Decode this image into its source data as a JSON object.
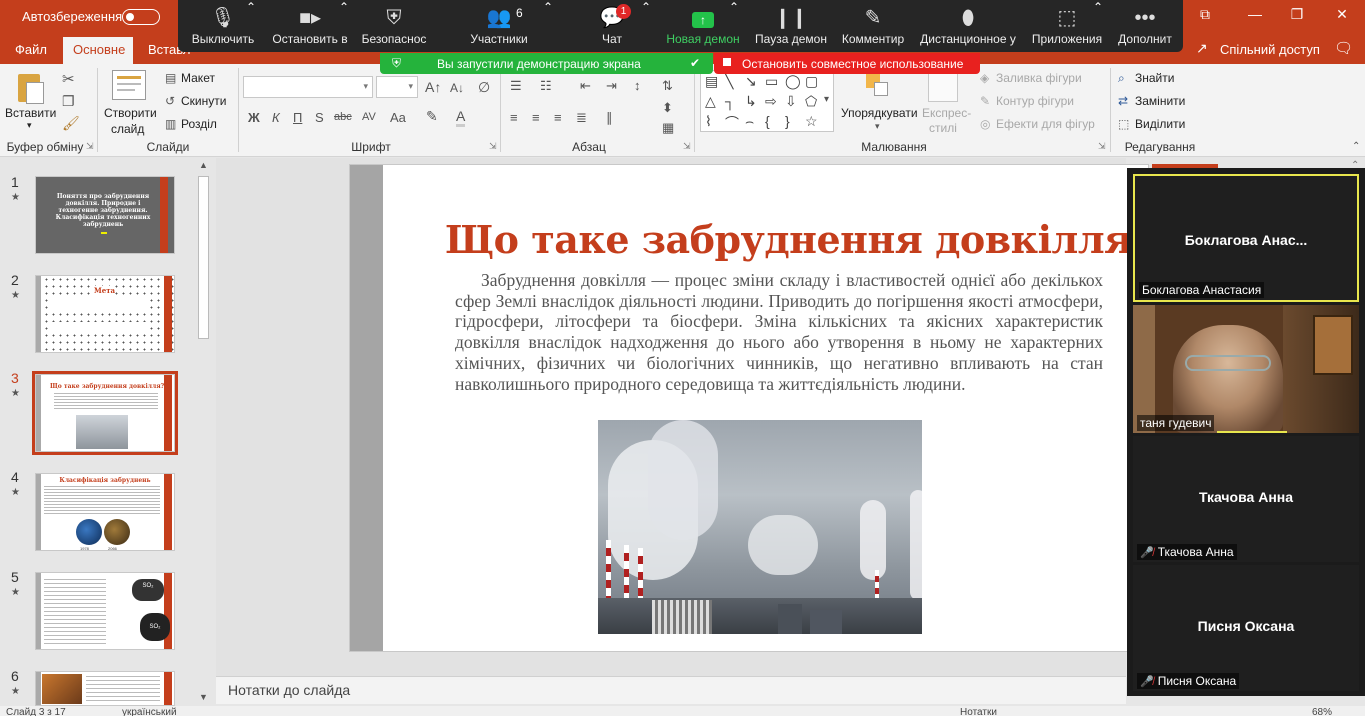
{
  "app": {
    "autosave_label": "Автозбереження",
    "autosave_state": "off",
    "share_label": "Спільний доступ",
    "accent": "#c43e1c",
    "window_controls": [
      "restore-small-icon",
      "minimize-icon",
      "maximize-icon",
      "close-icon"
    ]
  },
  "tabs": {
    "file": "Файл",
    "home": "Основне",
    "insert": "Вставл"
  },
  "zoom": {
    "mute": "Выключить",
    "stop_video": "Остановить в",
    "security": "Безопаснос",
    "participants": "Участники",
    "participants_count": "6",
    "chat": "Чат",
    "chat_badge": "1",
    "new_share": "Новая демон",
    "pause_share": "Пауза демон",
    "annotate": "Комментир",
    "remote": "Дистанционное у",
    "apps": "Приложения",
    "more": "Дополнит",
    "sharing_banner": "Вы запустили демонстрацию экрана",
    "stop_share": "Остановить совместное использование"
  },
  "ribbon": {
    "paste": "Вставити",
    "clipboard": "Буфер обміну",
    "new_slide_line1": "Створити",
    "new_slide_line2": "слайд",
    "layout": "Макет",
    "reset": "Скинути",
    "section": "Розділ",
    "slides": "Слайди",
    "font_group": "Шрифт",
    "paragraph": "Абзац",
    "arrange": "Упорядкувати",
    "quick_styles_line1": "Експрес-",
    "quick_styles_line2": "стилі",
    "shape_fill": "Заливка фігури",
    "shape_outline": "Контур фігури",
    "shape_effects": "Ефекти для фігур",
    "drawing": "Малювання",
    "find": "Знайти",
    "replace": "Замінити",
    "select": "Виділити",
    "editing": "Редагування",
    "bold": "Ж",
    "italic": "К",
    "underline": "П",
    "strike": "S",
    "abc": "abc",
    "spacing": "AV",
    "case": "Aa"
  },
  "thumbnails": [
    {
      "num": "1",
      "title": "Поняття про забруднення довкілля. Природне і техногенне забруднення. Класифікація техногенних забруднень",
      "selected": false
    },
    {
      "num": "2",
      "title": "Мета",
      "selected": false
    },
    {
      "num": "3",
      "title": "Що таке забруднення довкілля?",
      "selected": true
    },
    {
      "num": "4",
      "title": "Класифікація забруднень",
      "selected": false
    },
    {
      "num": "5",
      "title": "",
      "selected": false
    },
    {
      "num": "6",
      "title": "",
      "selected": false
    }
  ],
  "thumb4_years": [
    "1978",
    "2066"
  ],
  "thumb5_badges": [
    "SO₂",
    "SO₂"
  ],
  "slide": {
    "title": "Що таке забруднення довкілля?",
    "body": "Забруднення довкілля — процес зміни складу і властивостей однієї або декількох сфер Землі внаслідок діяльності людини. Приводить до погіршення якості атмосфери, гідросфери, літосфери та біосфери. Зміна кількісних та якісних характеристик довкілля внаслідок надходження до нього або утворення в ньому не характерних хімічних, фізичних чи біологічних чинників, що негативно впливають на стан навколишнього природного середовища та життєдіяльність людини."
  },
  "notes_placeholder": "Нотатки до слайда",
  "status": {
    "slide_info": "Слайд 3 з 17",
    "language": "український",
    "notes": "Нотатки",
    "zoom": "68%"
  },
  "participants": [
    {
      "display": "Боклагова  Анас...",
      "tag": "Боклагова Анастасия",
      "muted": false,
      "video": false,
      "active": true
    },
    {
      "display": "",
      "tag": "таня гудевич",
      "muted": false,
      "video": true,
      "active": false
    },
    {
      "display": "Ткачова Анна",
      "tag": "Ткачова Анна",
      "muted": true,
      "video": false,
      "active": false
    },
    {
      "display": "Писня Оксана",
      "tag": "Писня Оксана",
      "muted": true,
      "video": false,
      "active": false
    }
  ]
}
